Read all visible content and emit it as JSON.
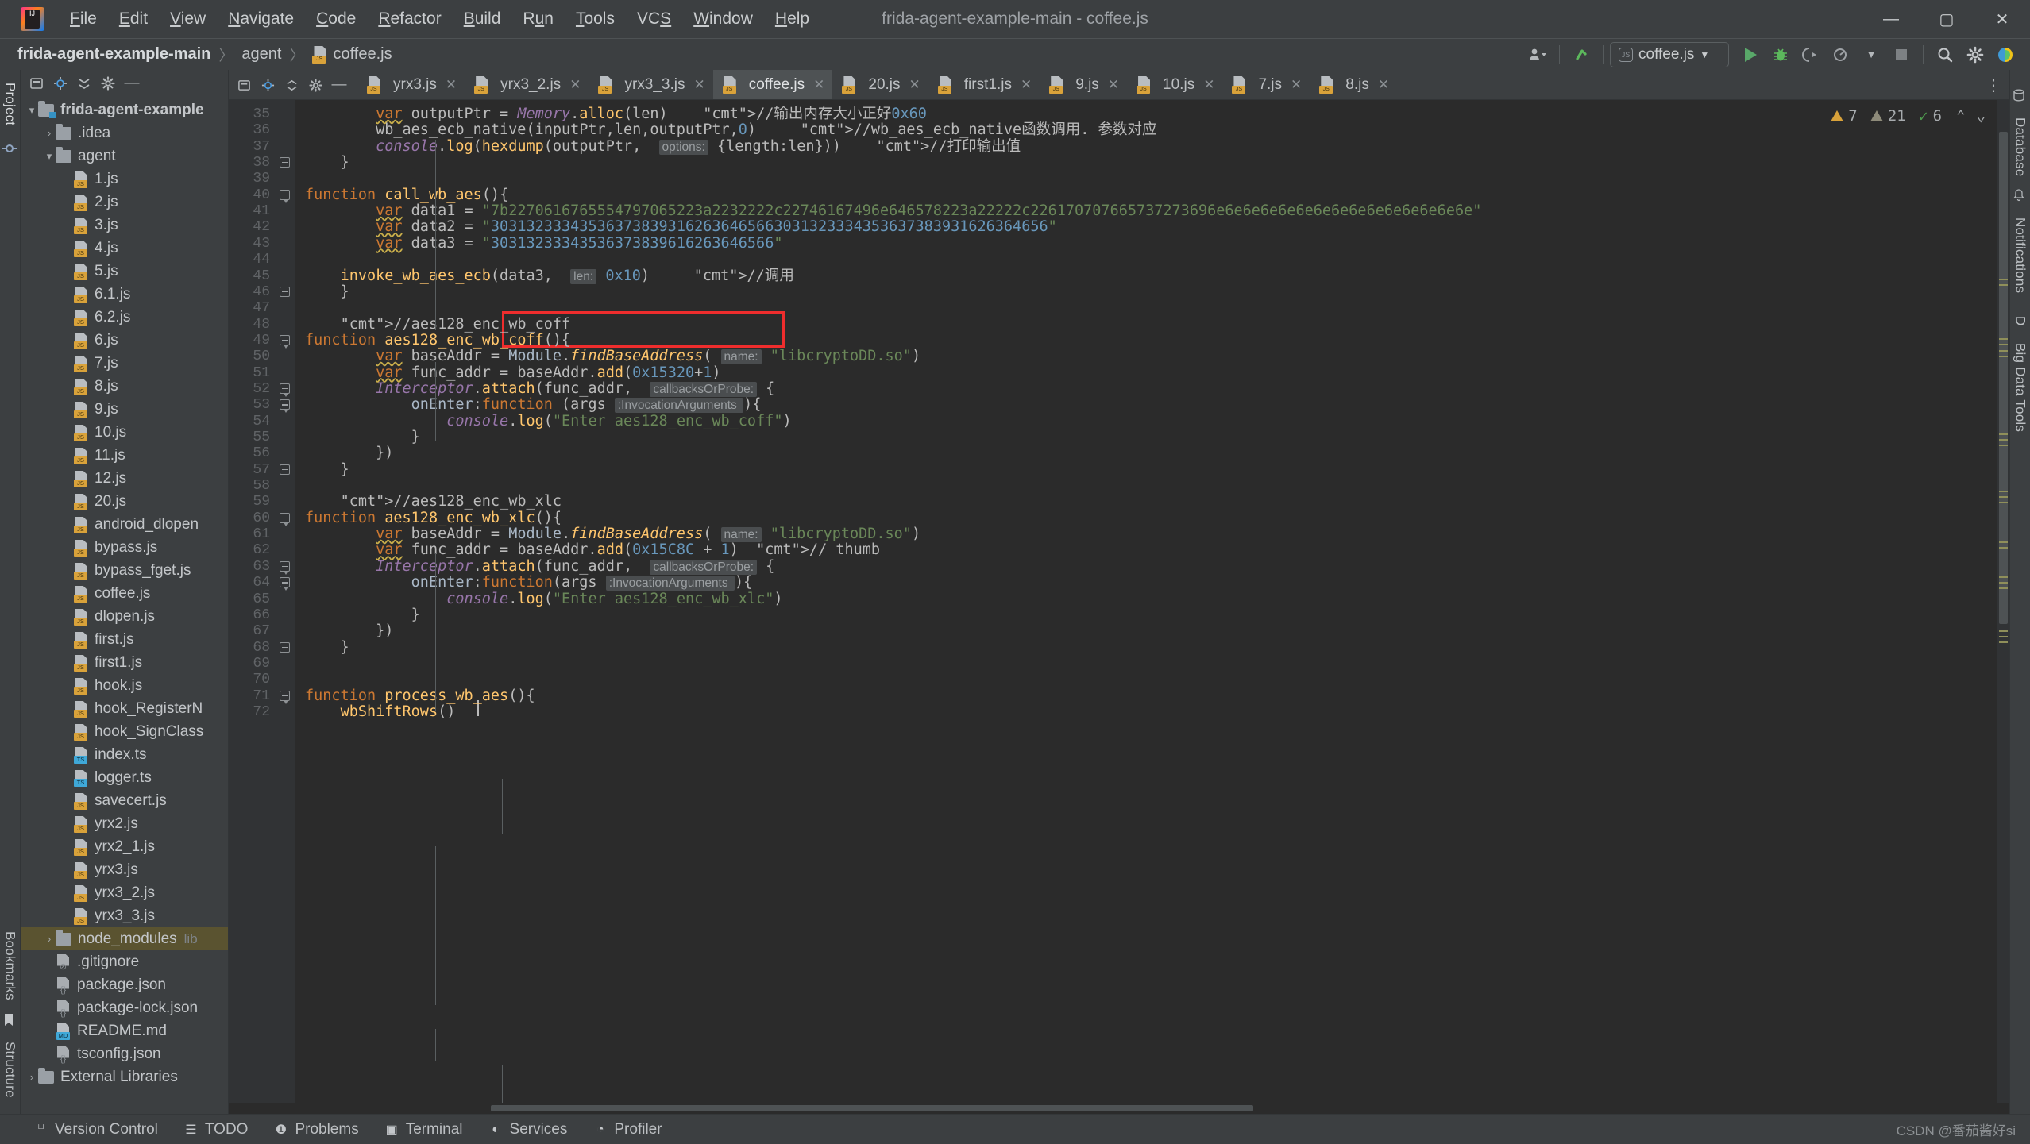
{
  "window": {
    "title": "frida-agent-example-main - coffee.js",
    "logo_text": "IJ",
    "minimize": "—",
    "maximize": "▢",
    "close": "✕"
  },
  "menu": [
    "File",
    "Edit",
    "View",
    "Navigate",
    "Code",
    "Refactor",
    "Build",
    "Run",
    "Tools",
    "VCS",
    "Window",
    "Help"
  ],
  "breadcrumb": {
    "project": "frida-agent-example-main",
    "folder": "agent",
    "file": "coffee.js",
    "separator": "〉"
  },
  "navbar_right": {
    "run_config": "coffee.js",
    "run_config_icon": "js-node-icon",
    "account_icon": "account-icon",
    "updates_icon": "update-arrow-icon",
    "run_icon": "run-icon",
    "debug_icon": "debug-icon",
    "coverage_icon": "run-with-coverage-icon",
    "profile_icon": "profile-icon",
    "stop_icon": "stop-icon",
    "search_icon": "search-everywhere-icon",
    "settings_icon": "settings-gear-icon",
    "ai_icon": "ai-assistant-icon"
  },
  "left_strip": {
    "project_label": "Project",
    "bookmarks_label": "Bookmarks",
    "structure_label": "Structure"
  },
  "right_strip": {
    "database_label": "Database",
    "notifications_label": "Notifications",
    "bigdata_label": "Big Data Tools",
    "d_label": "D"
  },
  "project_toolbar": {
    "select_opened_icon": "crosshair-icon",
    "expand_icon": "expand-all-icon",
    "collapse_icon": "collapse-all-icon",
    "settings_icon": "gear-icon",
    "hide_icon": "hide-icon"
  },
  "tree": [
    {
      "label": "frida-agent-example",
      "type": "module-folder",
      "indent": 0,
      "arrow": "▾",
      "selected": false
    },
    {
      "label": ".idea",
      "type": "folder",
      "indent": 1,
      "arrow": "›",
      "selected": false
    },
    {
      "label": "agent",
      "type": "folder",
      "indent": 1,
      "arrow": "▾",
      "selected": false
    },
    {
      "label": "1.js",
      "type": "js",
      "indent": 2,
      "arrow": "",
      "selected": false
    },
    {
      "label": "2.js",
      "type": "js",
      "indent": 2,
      "arrow": "",
      "selected": false
    },
    {
      "label": "3.js",
      "type": "js",
      "indent": 2,
      "arrow": "",
      "selected": false
    },
    {
      "label": "4.js",
      "type": "js",
      "indent": 2,
      "arrow": "",
      "selected": false
    },
    {
      "label": "5.js",
      "type": "js",
      "indent": 2,
      "arrow": "",
      "selected": false
    },
    {
      "label": "6.1.js",
      "type": "js",
      "indent": 2,
      "arrow": "",
      "selected": false
    },
    {
      "label": "6.2.js",
      "type": "js",
      "indent": 2,
      "arrow": "",
      "selected": false
    },
    {
      "label": "6.js",
      "type": "js",
      "indent": 2,
      "arrow": "",
      "selected": false
    },
    {
      "label": "7.js",
      "type": "js",
      "indent": 2,
      "arrow": "",
      "selected": false
    },
    {
      "label": "8.js",
      "type": "js",
      "indent": 2,
      "arrow": "",
      "selected": false
    },
    {
      "label": "9.js",
      "type": "js",
      "indent": 2,
      "arrow": "",
      "selected": false
    },
    {
      "label": "10.js",
      "type": "js",
      "indent": 2,
      "arrow": "",
      "selected": false
    },
    {
      "label": "11.js",
      "type": "js",
      "indent": 2,
      "arrow": "",
      "selected": false
    },
    {
      "label": "12.js",
      "type": "js",
      "indent": 2,
      "arrow": "",
      "selected": false
    },
    {
      "label": "20.js",
      "type": "js",
      "indent": 2,
      "arrow": "",
      "selected": false
    },
    {
      "label": "android_dlopen",
      "type": "js",
      "indent": 2,
      "arrow": "",
      "selected": false
    },
    {
      "label": "bypass.js",
      "type": "js",
      "indent": 2,
      "arrow": "",
      "selected": false
    },
    {
      "label": "bypass_fget.js",
      "type": "js",
      "indent": 2,
      "arrow": "",
      "selected": false
    },
    {
      "label": "coffee.js",
      "type": "js",
      "indent": 2,
      "arrow": "",
      "selected": false
    },
    {
      "label": "dlopen.js",
      "type": "js",
      "indent": 2,
      "arrow": "",
      "selected": false
    },
    {
      "label": "first.js",
      "type": "js",
      "indent": 2,
      "arrow": "",
      "selected": false
    },
    {
      "label": "first1.js",
      "type": "js",
      "indent": 2,
      "arrow": "",
      "selected": false
    },
    {
      "label": "hook.js",
      "type": "js",
      "indent": 2,
      "arrow": "",
      "selected": false
    },
    {
      "label": "hook_RegisterN",
      "type": "js",
      "indent": 2,
      "arrow": "",
      "selected": false
    },
    {
      "label": "hook_SignClass",
      "type": "js",
      "indent": 2,
      "arrow": "",
      "selected": false
    },
    {
      "label": "index.ts",
      "type": "ts",
      "indent": 2,
      "arrow": "",
      "selected": false
    },
    {
      "label": "logger.ts",
      "type": "ts",
      "indent": 2,
      "arrow": "",
      "selected": false
    },
    {
      "label": "savecert.js",
      "type": "js",
      "indent": 2,
      "arrow": "",
      "selected": false
    },
    {
      "label": "yrx2.js",
      "type": "js",
      "indent": 2,
      "arrow": "",
      "selected": false
    },
    {
      "label": "yrx2_1.js",
      "type": "js",
      "indent": 2,
      "arrow": "",
      "selected": false
    },
    {
      "label": "yrx3.js",
      "type": "js",
      "indent": 2,
      "arrow": "",
      "selected": false
    },
    {
      "label": "yrx3_2.js",
      "type": "js",
      "indent": 2,
      "arrow": "",
      "selected": false
    },
    {
      "label": "yrx3_3.js",
      "type": "js",
      "indent": 2,
      "arrow": "",
      "selected": false
    },
    {
      "label": "node_modules",
      "type": "folder",
      "indent": 1,
      "arrow": "›",
      "selected": true,
      "suffix": "lib"
    },
    {
      "label": ".gitignore",
      "type": "git",
      "indent": 1,
      "arrow": "",
      "selected": false
    },
    {
      "label": "package.json",
      "type": "json",
      "indent": 1,
      "arrow": "",
      "selected": false
    },
    {
      "label": "package-lock.json",
      "type": "json",
      "indent": 1,
      "arrow": "",
      "selected": false
    },
    {
      "label": "README.md",
      "type": "md",
      "indent": 1,
      "arrow": "",
      "selected": false
    },
    {
      "label": "tsconfig.json",
      "type": "json",
      "indent": 1,
      "arrow": "",
      "selected": false
    },
    {
      "label": "External Libraries",
      "type": "libs",
      "indent": 0,
      "arrow": "›",
      "selected": false
    }
  ],
  "tabs": [
    {
      "label": "yrx3.js",
      "active": false
    },
    {
      "label": "yrx3_2.js",
      "active": false
    },
    {
      "label": "yrx3_3.js",
      "active": false
    },
    {
      "label": "coffee.js",
      "active": true
    },
    {
      "label": "20.js",
      "active": false
    },
    {
      "label": "first1.js",
      "active": false
    },
    {
      "label": "9.js",
      "active": false
    },
    {
      "label": "10.js",
      "active": false
    },
    {
      "label": "7.js",
      "active": false
    },
    {
      "label": "8.js",
      "active": false
    }
  ],
  "inspection": {
    "errors": "7",
    "warnings": "21",
    "typos": "6",
    "up": "⌃",
    "down": "⌄"
  },
  "editor": {
    "first_line": 35,
    "last_line": 72,
    "highlight_box_line": 45,
    "lines": [
      {
        "n": 35,
        "text": "        var outputPtr = Memory.alloc(len)    //输出内存大小正好0x60"
      },
      {
        "n": 36,
        "text": "        wb_aes_ecb_native(inputPtr,len,outputPtr,0)     //wb_aes_ecb_native函数调用. 参数对应"
      },
      {
        "n": 37,
        "text": "        console.log(hexdump(outputPtr,  options: {length:len}))    //打印输出值"
      },
      {
        "n": 38,
        "text": "    }"
      },
      {
        "n": 39,
        "text": ""
      },
      {
        "n": 40,
        "text": "function call_wb_aes(){"
      },
      {
        "n": 41,
        "text": "        var data1 = \"7b2270616765554797065223a2232222c22746167496e646578223a22222c226170707665737273696e6e6e6e6e6e6e6e6e6e6e6e6e6e6e\""
      },
      {
        "n": 42,
        "text": "        var data2 = \"303132333435363738393162636465663031323334353637383931626364656\""
      },
      {
        "n": 43,
        "text": "        var data3 = \"30313233343536373839616263646566\""
      },
      {
        "n": 44,
        "text": ""
      },
      {
        "n": 45,
        "text": "    invoke_wb_aes_ecb(data3,  len: 0x10)     //调用"
      },
      {
        "n": 46,
        "text": "    }"
      },
      {
        "n": 47,
        "text": ""
      },
      {
        "n": 48,
        "text": "    //aes128_enc_wb_coff"
      },
      {
        "n": 49,
        "text": "function aes128_enc_wb_coff(){"
      },
      {
        "n": 50,
        "text": "        var baseAddr = Module.findBaseAddress( name: \"libcryptoDD.so\")"
      },
      {
        "n": 51,
        "text": "        var func_addr = baseAddr.add(0x15320+1)"
      },
      {
        "n": 52,
        "text": "        Interceptor.attach(func_addr,  callbacksOrProbe: {"
      },
      {
        "n": 53,
        "text": "            onEnter:function (args :InvocationArguments ){"
      },
      {
        "n": 54,
        "text": "                console.log(\"Enter aes128_enc_wb_coff\")"
      },
      {
        "n": 55,
        "text": "            }"
      },
      {
        "n": 56,
        "text": "        })"
      },
      {
        "n": 57,
        "text": "    }"
      },
      {
        "n": 58,
        "text": ""
      },
      {
        "n": 59,
        "text": "    //aes128_enc_wb_xlc"
      },
      {
        "n": 60,
        "text": "function aes128_enc_wb_xlc(){"
      },
      {
        "n": 61,
        "text": "        var baseAddr = Module.findBaseAddress( name: \"libcryptoDD.so\")"
      },
      {
        "n": 62,
        "text": "        var func_addr = baseAddr.add(0x15C8C + 1)  // thumb"
      },
      {
        "n": 63,
        "text": "        Interceptor.attach(func_addr,  callbacksOrProbe: {"
      },
      {
        "n": 64,
        "text": "            onEnter:function(args :InvocationArguments ){"
      },
      {
        "n": 65,
        "text": "                console.log(\"Enter aes128_enc_wb_xlc\")"
      },
      {
        "n": 66,
        "text": "            }"
      },
      {
        "n": 67,
        "text": "        })"
      },
      {
        "n": 68,
        "text": "    }"
      },
      {
        "n": 69,
        "text": ""
      },
      {
        "n": 70,
        "text": ""
      },
      {
        "n": 71,
        "text": "function process_wb_aes(){"
      },
      {
        "n": 72,
        "text": "    wbShiftRows()"
      }
    ],
    "hint_options": "options:",
    "hint_len": "len:",
    "hint_name": "name:",
    "hint_callbacks": "callbacksOrProbe:",
    "hint_args": ":InvocationArguments"
  },
  "statusbar": {
    "items": [
      {
        "label": "Version Control",
        "icon": "branch-icon"
      },
      {
        "label": "TODO",
        "icon": "todo-list-icon"
      },
      {
        "label": "Problems",
        "icon": "problems-icon"
      },
      {
        "label": "Terminal",
        "icon": "terminal-icon"
      },
      {
        "label": "Services",
        "icon": "services-icon"
      },
      {
        "label": "Profiler",
        "icon": "profiler-icon"
      }
    ],
    "watermark": "CSDN @番茄酱好si"
  },
  "colors": {
    "accent_red": "#ef2d2d",
    "keyword": "#cc7832",
    "string": "#6a8759",
    "number": "#6897bb",
    "comment": "#808080",
    "function": "#ffc66d",
    "class": "#9876aa",
    "editor_bg": "#2b2b2b",
    "chrome_bg": "#3c3f41"
  }
}
